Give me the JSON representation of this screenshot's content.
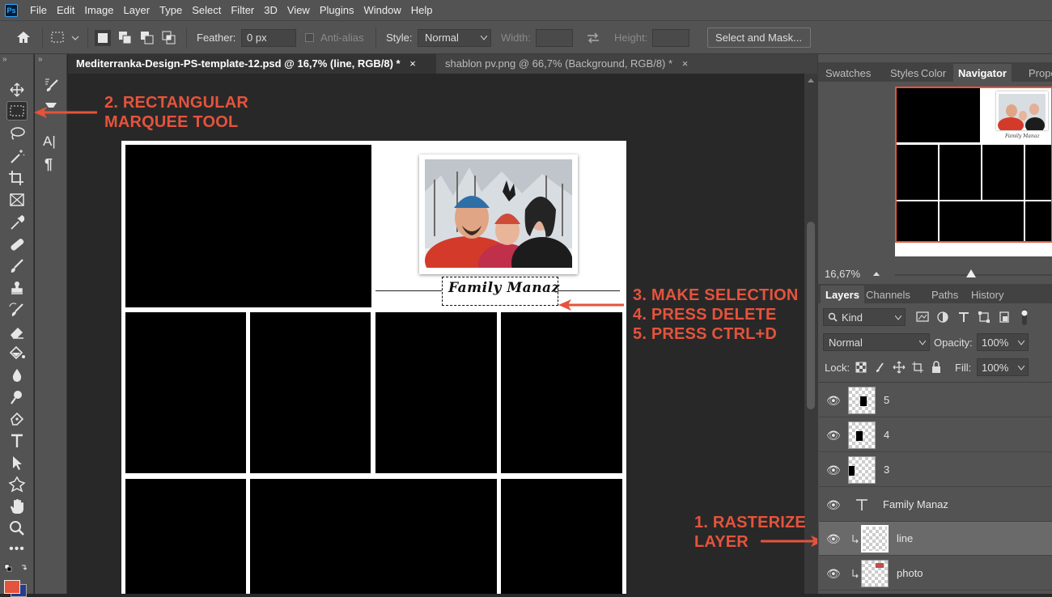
{
  "menubar": {
    "items": [
      "File",
      "Edit",
      "Image",
      "Layer",
      "Type",
      "Select",
      "Filter",
      "3D",
      "View",
      "Plugins",
      "Window",
      "Help"
    ],
    "logo": "Ps"
  },
  "options": {
    "feather_label": "Feather:",
    "feather_value": "0 px",
    "antialias_label": "Anti-alias",
    "style_label": "Style:",
    "style_value": "Normal",
    "width_label": "Width:",
    "height_label": "Height:",
    "select_mask_label": "Select and Mask..."
  },
  "tabs": [
    {
      "label": "Mediterranka-Design-PS-template-12.psd @ 16,7% (line, RGB/8) *",
      "close": "×"
    },
    {
      "label": "shablon pv.png @ 66,7% (Background, RGB/8) *",
      "close": "×"
    }
  ],
  "document": {
    "caption": "Family Manaz"
  },
  "annotations": {
    "marquee_line1": "2. RECTANGULAR",
    "marquee_line2": "MARQUEE TOOL",
    "selection_line1": "3. MAKE SELECTION",
    "selection_line2": "4. PRESS DELETE",
    "selection_line3": "5. PRESS CTRL+D",
    "rasterize_line1": "1. RASTERIZE",
    "rasterize_line2": "LAYER",
    "color": "#e5533c"
  },
  "navigator_panel": {
    "tabs": [
      "Swatches",
      "Styles",
      "Color",
      "Navigator",
      "Propert"
    ],
    "active_tab": "Navigator",
    "zoom": "16,67%"
  },
  "layers_panel": {
    "tabs": [
      "Layers",
      "Channels",
      "Paths",
      "History"
    ],
    "active_tab": "Layers",
    "kind_label": "Kind",
    "blend_mode": "Normal",
    "opacity_label": "Opacity:",
    "opacity_value": "100%",
    "lock_label": "Lock:",
    "fill_label": "Fill:",
    "fill_value": "100%",
    "layers": [
      {
        "name": "5",
        "type": "image",
        "selected": false
      },
      {
        "name": "4",
        "type": "image",
        "selected": false
      },
      {
        "name": "3",
        "type": "image",
        "selected": false
      },
      {
        "name": "Family Manaz",
        "type": "text",
        "selected": false
      },
      {
        "name": "line",
        "type": "image",
        "selected": true
      },
      {
        "name": "photo",
        "type": "image",
        "selected": false
      }
    ]
  },
  "colors": {
    "foreground": "#e5533c",
    "background": "#2a3a8c"
  }
}
